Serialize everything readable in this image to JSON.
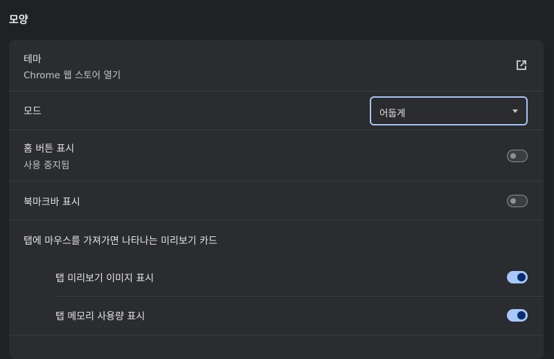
{
  "section": {
    "title": "모양"
  },
  "theme": {
    "label": "테마",
    "sublabel": "Chrome 웹 스토어 열기",
    "icon": "open-in-new-icon"
  },
  "mode": {
    "label": "모드",
    "selected": "어둡게"
  },
  "home_button": {
    "label": "홈 버튼 표시",
    "sublabel": "사용 중지됨",
    "enabled": false
  },
  "bookmarks_bar": {
    "label": "북마크바 표시",
    "enabled": false
  },
  "tab_hover": {
    "label": "탭에 마우스를 가져가면 나타나는 미리보기 카드"
  },
  "tab_preview_image": {
    "label": "탭 미리보기 이미지 표시",
    "enabled": true
  },
  "tab_memory": {
    "label": "탭 메모리 사용량 표시",
    "enabled": true
  },
  "colors": {
    "background": "#202124",
    "card": "#2b2c2f",
    "accent": "#a8c7fa",
    "knob_on": "#062e6f"
  }
}
